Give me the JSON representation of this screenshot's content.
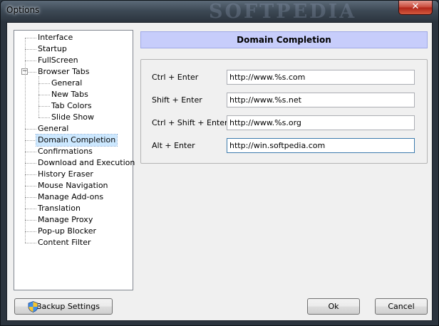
{
  "window": {
    "title": "Options",
    "watermark": "SOFTPEDIA",
    "close_glyph": "✕"
  },
  "tree": {
    "items": [
      {
        "label": "Interface",
        "level": 0
      },
      {
        "label": "Startup",
        "level": 0
      },
      {
        "label": "FullScreen",
        "level": 0
      },
      {
        "label": "Browser Tabs",
        "level": 0,
        "expanded": true
      },
      {
        "label": "General",
        "level": 1
      },
      {
        "label": "New Tabs",
        "level": 1
      },
      {
        "label": "Tab Colors",
        "level": 1
      },
      {
        "label": "Slide Show",
        "level": 1
      },
      {
        "label": "General",
        "level": 0
      },
      {
        "label": "Domain Completion",
        "level": 0,
        "selected": true
      },
      {
        "label": "Confirmations",
        "level": 0
      },
      {
        "label": "Download and Execution",
        "level": 0
      },
      {
        "label": "History Eraser",
        "level": 0
      },
      {
        "label": "Mouse Navigation",
        "level": 0
      },
      {
        "label": "Manage Add-ons",
        "level": 0
      },
      {
        "label": "Translation",
        "level": 0
      },
      {
        "label": "Manage Proxy",
        "level": 0
      },
      {
        "label": "Pop-up Blocker",
        "level": 0
      },
      {
        "label": "Content Filter",
        "level": 0
      }
    ],
    "collapse_glyph": "−"
  },
  "panel": {
    "header": "Domain Completion",
    "rows": [
      {
        "label": "Ctrl + Enter",
        "value": "http://www.%s.com"
      },
      {
        "label": "Shift + Enter",
        "value": "http://www.%s.net"
      },
      {
        "label": "Ctrl + Shift + Enter",
        "value": "http://www.%s.org"
      },
      {
        "label": "Alt + Enter",
        "value": "http://win.softpedia.com"
      }
    ]
  },
  "buttons": {
    "backup": "Backup Settings",
    "ok": "Ok",
    "cancel": "Cancel"
  },
  "icons": {
    "backup_icon": "shield-icon"
  },
  "colors": {
    "header_bg": "#c7cdfb",
    "selection": "#cce8ff",
    "close_red": "#c94a3a"
  }
}
